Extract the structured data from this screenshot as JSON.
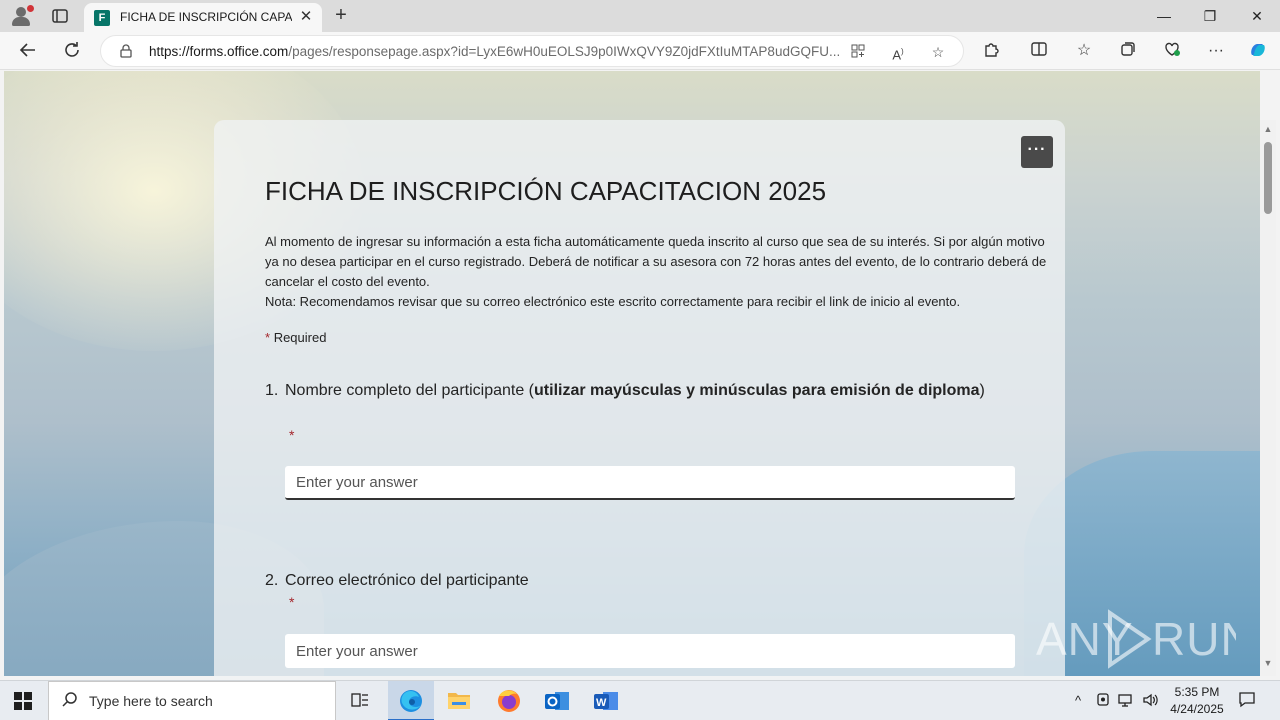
{
  "browser": {
    "tab_title": "FICHA DE INSCRIPCIÓN CAPACITACION 2025",
    "favicon_letter": "F",
    "url_host": "https://forms.office.com",
    "url_rest": "/pages/responsepage.aspx?id=LyxE6wH0uEOLSJ9p0IWxQVY9Z0jdFXtIuMTAP8udGQFU...",
    "window_controls": {
      "minimize": "—",
      "restore": "❐",
      "close": "✕"
    }
  },
  "form": {
    "more_label": "···",
    "title": "FICHA DE INSCRIPCIÓN CAPACITACION 2025",
    "description_line1": "Al momento de ingresar su información a esta ficha automáticamente queda inscrito al curso que sea de su interés. Si por algún motivo ya no desea participar en el curso registrado. Deberá de notificar a su asesora con 72 horas antes del evento, de lo contrario deberá de cancelar el costo del evento.",
    "description_line2": "Nota: Recomendamos revisar que su correo electrónico este escrito correctamente para recibir el link de inicio al evento.",
    "required_star": "*",
    "required_label": "Required",
    "questions": [
      {
        "number": "1.",
        "text_normal_start": "Nombre completo del participante (",
        "text_bold": "utilizar mayúsculas y minúsculas para emisión de diploma",
        "text_normal_end": ")",
        "required_mark": "*",
        "placeholder": "Enter your answer"
      },
      {
        "number": "2.",
        "text": "Correo electrónico del participante",
        "required_mark": "*",
        "placeholder": "Enter your answer"
      }
    ]
  },
  "watermark": "ANY RUN",
  "taskbar": {
    "search_placeholder": "Type here to search",
    "time": "5:35 PM",
    "date": "4/24/2025"
  }
}
